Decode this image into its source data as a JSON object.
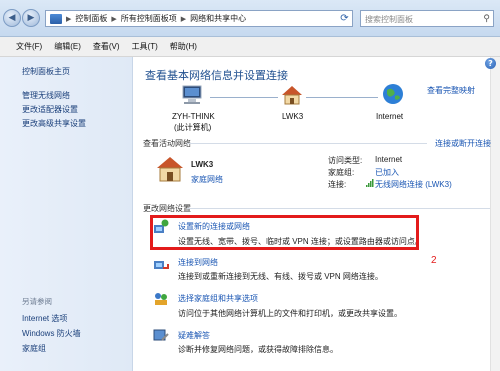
{
  "address_bar": {
    "breadcrumbs": [
      "控制面板",
      "所有控制面板项",
      "网络和共享中心"
    ],
    "search_placeholder": "搜索控制面板"
  },
  "menu": [
    "文件(F)",
    "编辑(E)",
    "查看(V)",
    "工具(T)",
    "帮助(H)"
  ],
  "sidebar": {
    "home": "控制面板主页",
    "tasks": [
      "管理无线网络",
      "更改适配器设置",
      "更改高级共享设置"
    ],
    "see_also_header": "另请参阅",
    "see_also": [
      "Internet 选项",
      "Windows 防火墙",
      "家庭组"
    ]
  },
  "main": {
    "title": "查看基本网络信息并设置连接",
    "view_full_map": "查看完整映射",
    "map": {
      "computer_name": "ZYH-THINK",
      "computer_sub": "(此计算机)",
      "network_name": "LWK3",
      "internet": "Internet"
    },
    "active_networks_header": "查看活动网络",
    "connect_or_disconnect": "连接或断开连接",
    "active_network": {
      "name": "LWK3",
      "type": "家庭网络",
      "access_type_label": "访问类型:",
      "access_type_value": "Internet",
      "homegroup_label": "家庭组:",
      "homegroup_value": "已加入",
      "connection_label": "连接:",
      "connection_value": "无线网络连接 (LWK3)"
    },
    "change_settings_header": "更改网络设置",
    "tasks": [
      {
        "title": "设置新的连接或网络",
        "desc": "设置无线、宽带、拨号、临时或 VPN 连接；或设置路由器或访问点。",
        "icon": "new-connection-icon"
      },
      {
        "title": "连接到网络",
        "desc": "连接到或重新连接到无线、有线、拨号或 VPN 网络连接。",
        "icon": "connect-network-icon"
      },
      {
        "title": "选择家庭组和共享选项",
        "desc": "访问位于其他网络计算机上的文件和打印机，或更改共享设置。",
        "icon": "homegroup-icon"
      },
      {
        "title": "疑难解答",
        "desc": "诊断并修复网络问题，或获得故障排除信息。",
        "icon": "troubleshoot-icon"
      }
    ],
    "annotation_number": "2"
  },
  "colors": {
    "link": "#1a56b3",
    "highlight_box": "#e31b1b",
    "title": "#1f4f8f"
  }
}
